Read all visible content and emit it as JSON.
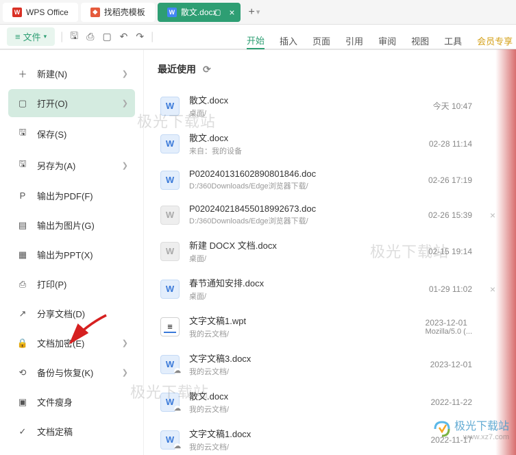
{
  "tabs": {
    "wps": "WPS Office",
    "doke": "找稻壳模板",
    "active": "散文.docx",
    "add": "+"
  },
  "toolbar": {
    "file_label": "文件"
  },
  "ribbon": {
    "start": "开始",
    "insert": "插入",
    "page": "页面",
    "ref": "引用",
    "review": "审阅",
    "view": "视图",
    "tools": "工具",
    "vip": "会员专享"
  },
  "sidebar": {
    "items": [
      {
        "label": "新建(N)",
        "icon": "＋"
      },
      {
        "label": "打开(O)",
        "icon": "▢"
      },
      {
        "label": "保存(S)",
        "icon": "🖫"
      },
      {
        "label": "另存为(A)",
        "icon": "🖫"
      },
      {
        "label": "输出为PDF(F)",
        "icon": "P"
      },
      {
        "label": "输出为图片(G)",
        "icon": "▤"
      },
      {
        "label": "输出为PPT(X)",
        "icon": "▦"
      },
      {
        "label": "打印(P)",
        "icon": "⎙"
      },
      {
        "label": "分享文档(D)",
        "icon": "↗"
      },
      {
        "label": "文档加密(E)",
        "icon": "🔒"
      },
      {
        "label": "备份与恢复(K)",
        "icon": "⟲"
      },
      {
        "label": "文件瘦身",
        "icon": "▣"
      },
      {
        "label": "文档定稿",
        "icon": "✓"
      }
    ]
  },
  "recent": {
    "header": "最近使用",
    "items": [
      {
        "name": "散文.docx",
        "path": "桌面/",
        "time": "今天 10:47",
        "type": "word"
      },
      {
        "name": "散文.docx",
        "path": "来自：我的设备",
        "time": "02-28 11:14",
        "type": "word"
      },
      {
        "name": "P020240131602890801846.doc",
        "path": "D:/360Downloads/Edge浏览器下载/",
        "time": "02-26 17:19",
        "type": "word"
      },
      {
        "name": "P020240218455018992673.doc",
        "path": "D:/360Downloads/Edge浏览器下载/",
        "time": "02-26 15:39",
        "type": "word-g",
        "removable": true
      },
      {
        "name": "新建 DOCX 文档.docx",
        "path": "桌面/",
        "time": "02-15 19:14",
        "type": "word-g"
      },
      {
        "name": "春节通知安排.docx",
        "path": "桌面/",
        "time": "01-29 11:02",
        "type": "word",
        "removable": true
      },
      {
        "name": "文字文稿1.wpt",
        "path": "我的云文档/",
        "time": "2023-12-01",
        "time2": "Mozilla/5.0 (...",
        "type": "wpt"
      },
      {
        "name": "文字文稿3.docx",
        "path": "我的云文档/",
        "time": "2023-12-01",
        "type": "word",
        "cloud": true
      },
      {
        "name": "散文.docx",
        "path": "我的云文档/",
        "time": "2022-11-22",
        "type": "word",
        "cloud": true
      },
      {
        "name": "文字文稿1.docx",
        "path": "我的云文档/",
        "time": "2022-11-17",
        "type": "word",
        "cloud": true
      }
    ]
  },
  "watermark": {
    "text": "极光下载站",
    "url": "www.xz7.com"
  }
}
